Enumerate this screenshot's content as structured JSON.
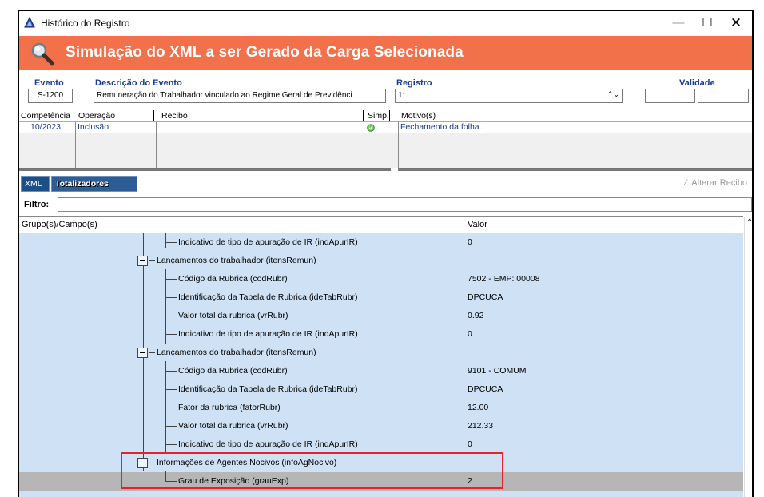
{
  "window": {
    "title": "Histórico do Registro",
    "minimize": "—",
    "maximize": "☐",
    "close": "✕"
  },
  "banner": {
    "title": "Simulação do XML a ser Gerado da Carga Selecionada",
    "icon": "search-icon"
  },
  "event": {
    "evento_label": "Evento",
    "evento_value": "S-1200",
    "descricao_label": "Descrição do Evento",
    "descricao_value": "Remuneração do Trabalhador vinculado ao Regime Geral de Previdênci",
    "registro_label": "Registro",
    "registro_value": "1:",
    "validade_label": "Validade",
    "validade_start": "",
    "validade_end": ""
  },
  "history_grid": {
    "columns": [
      "Competência",
      "Operação",
      "Recibo",
      "Simp.",
      "Motivo(s)"
    ],
    "rows": [
      {
        "competencia": "10/2023",
        "operacao": "Inclusão",
        "recibo": "",
        "simp": "check-icon",
        "motivo": "Fechamento da folha."
      }
    ]
  },
  "tabs": {
    "xml": "XML",
    "totalizadores": "Totalizadores",
    "alterar_recibo": "Alterar Recibo"
  },
  "filter": {
    "label": "Filtro:",
    "value": ""
  },
  "tree": {
    "col_group": "Grupo(s)/Campo(s)",
    "col_value": "Valor",
    "rows": [
      {
        "label": "Indicativo de tipo de apuração de IR (indApurIR)",
        "value": "0"
      },
      {
        "label": "Lançamentos do trabalhador (itensRemun)",
        "value": ""
      },
      {
        "label": "Código da Rubrica (codRubr)",
        "value": "7502 - EMP: 00008"
      },
      {
        "label": "Identificação da Tabela de Rubrica (ideTabRubr)",
        "value": "DPCUCA"
      },
      {
        "label": "Valor total da rubrica (vrRubr)",
        "value": "0.92"
      },
      {
        "label": "Indicativo de tipo de apuração de IR (indApurIR)",
        "value": "0"
      },
      {
        "label": "Lançamentos do trabalhador (itensRemun)",
        "value": ""
      },
      {
        "label": "Código da Rubrica (codRubr)",
        "value": "9101 - COMUM"
      },
      {
        "label": "Identificação da Tabela de Rubrica (ideTabRubr)",
        "value": "DPCUCA"
      },
      {
        "label": "Fator da rubrica (fatorRubr)",
        "value": "12.00"
      },
      {
        "label": "Valor total da rubrica (vrRubr)",
        "value": "212.33"
      },
      {
        "label": "Indicativo de tipo de apuração de IR (indApurIR)",
        "value": "0"
      },
      {
        "label": "Informações de Agentes Nocivos (infoAgNocivo)",
        "value": ""
      },
      {
        "label": "Grau de Exposição (grauExp)",
        "value": "2"
      }
    ]
  },
  "colors": {
    "banner": "#f2704a",
    "tree_bg": "#cfe2f5",
    "selected_row": "#b6b6b6",
    "label_blue": "#1a3a8c",
    "highlight": "#e8202a"
  }
}
